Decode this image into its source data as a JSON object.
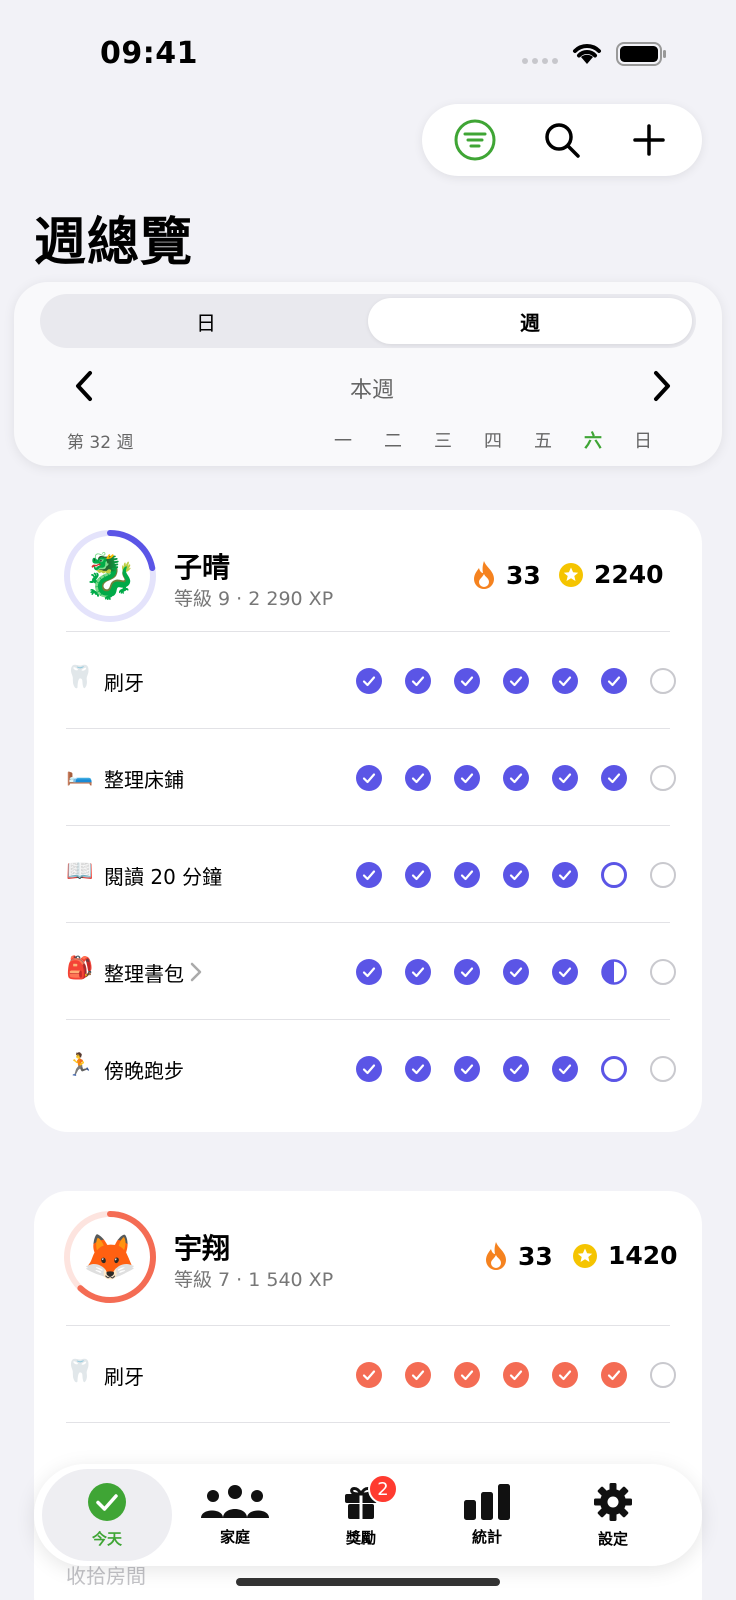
{
  "status": {
    "time": "09:41"
  },
  "toolbar": {
    "icons": [
      "filter-icon",
      "search-icon",
      "plus-icon"
    ]
  },
  "title": "週總覽",
  "selector": {
    "segments": [
      "日",
      "週"
    ],
    "selected": "週",
    "period_label": "本週",
    "week_number": "第 32 週",
    "weekdays": [
      "一",
      "二",
      "三",
      "四",
      "五",
      "六",
      "日"
    ],
    "today_index": 5
  },
  "colors": {
    "kid1": "#5b55e6",
    "kid2": "#f46c54",
    "accent": "#3fa535",
    "flame": "#f5821f",
    "star": "#f5c400"
  },
  "kids": [
    {
      "name": "子晴",
      "level": "等級 9 · 2 290 XP",
      "avatar": "🐉",
      "streak": "33",
      "stars": "2240",
      "progress": 0.22,
      "tasks": [
        {
          "icon": "🦷",
          "label": "刷牙",
          "status": [
            "done",
            "done",
            "done",
            "done",
            "done",
            "done",
            "empty"
          ]
        },
        {
          "icon": "🛏️",
          "label": "整理床鋪",
          "status": [
            "done",
            "done",
            "done",
            "done",
            "done",
            "done",
            "empty"
          ]
        },
        {
          "icon": "📖",
          "label": "閱讀 20 分鐘",
          "status": [
            "done",
            "done",
            "done",
            "done",
            "done",
            "ring",
            "empty"
          ]
        },
        {
          "icon": "🎒",
          "label": "整理書包",
          "has_chevron": true,
          "status": [
            "done",
            "done",
            "done",
            "done",
            "done",
            "half",
            "empty"
          ]
        },
        {
          "icon": "🏃",
          "label": "傍晚跑步",
          "status": [
            "done",
            "done",
            "done",
            "done",
            "done",
            "ring",
            "empty"
          ]
        }
      ]
    },
    {
      "name": "宇翔",
      "level": "等級 7 · 1 540 XP",
      "avatar": "🦊",
      "streak": "33",
      "stars": "1420",
      "progress": 0.62,
      "tasks": [
        {
          "icon": "🦷",
          "label": "刷牙",
          "status": [
            "done",
            "done",
            "done",
            "done",
            "done",
            "done",
            "empty"
          ]
        }
      ]
    }
  ],
  "tabs": [
    {
      "label": "今天",
      "icon": "checkmark-circle-icon",
      "active": true
    },
    {
      "label": "家庭",
      "icon": "family-icon"
    },
    {
      "label": "獎勵",
      "icon": "gift-icon",
      "badge": "2"
    },
    {
      "label": "統計",
      "icon": "bar-chart-icon"
    },
    {
      "label": "設定",
      "icon": "gear-icon"
    }
  ],
  "ghost_row": "收拾房間"
}
